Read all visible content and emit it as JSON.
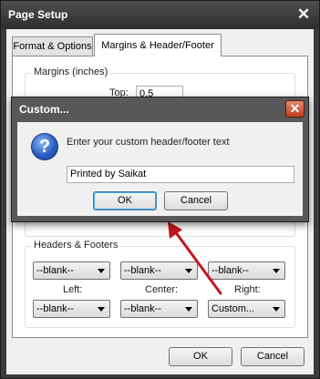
{
  "window": {
    "title": "Page Setup",
    "close_glyph": "✕"
  },
  "tabs": [
    {
      "label": "Format & Options"
    },
    {
      "label": "Margins & Header/Footer"
    }
  ],
  "margins": {
    "group_label": "Margins (inches)",
    "top_label": "Top:",
    "top_value": "0.5"
  },
  "headers_footers": {
    "group_label": "Headers & Footers",
    "row1": [
      "--blank--",
      "--blank--",
      "--blank--"
    ],
    "left_label": "Left:",
    "center_label": "Center:",
    "right_label": "Right:",
    "row2": [
      "--blank--",
      "--blank--",
      "Custom..."
    ]
  },
  "footer_buttons": {
    "ok": "OK",
    "cancel": "Cancel"
  },
  "custom_dialog": {
    "title": "Custom...",
    "close_glyph": "✕",
    "icon_glyph": "?",
    "message": "Enter your custom header/footer text",
    "input_value": "Printed by Saikat",
    "ok": "OK",
    "cancel": "Cancel"
  },
  "colors": {
    "arrow": "#c0181e"
  }
}
